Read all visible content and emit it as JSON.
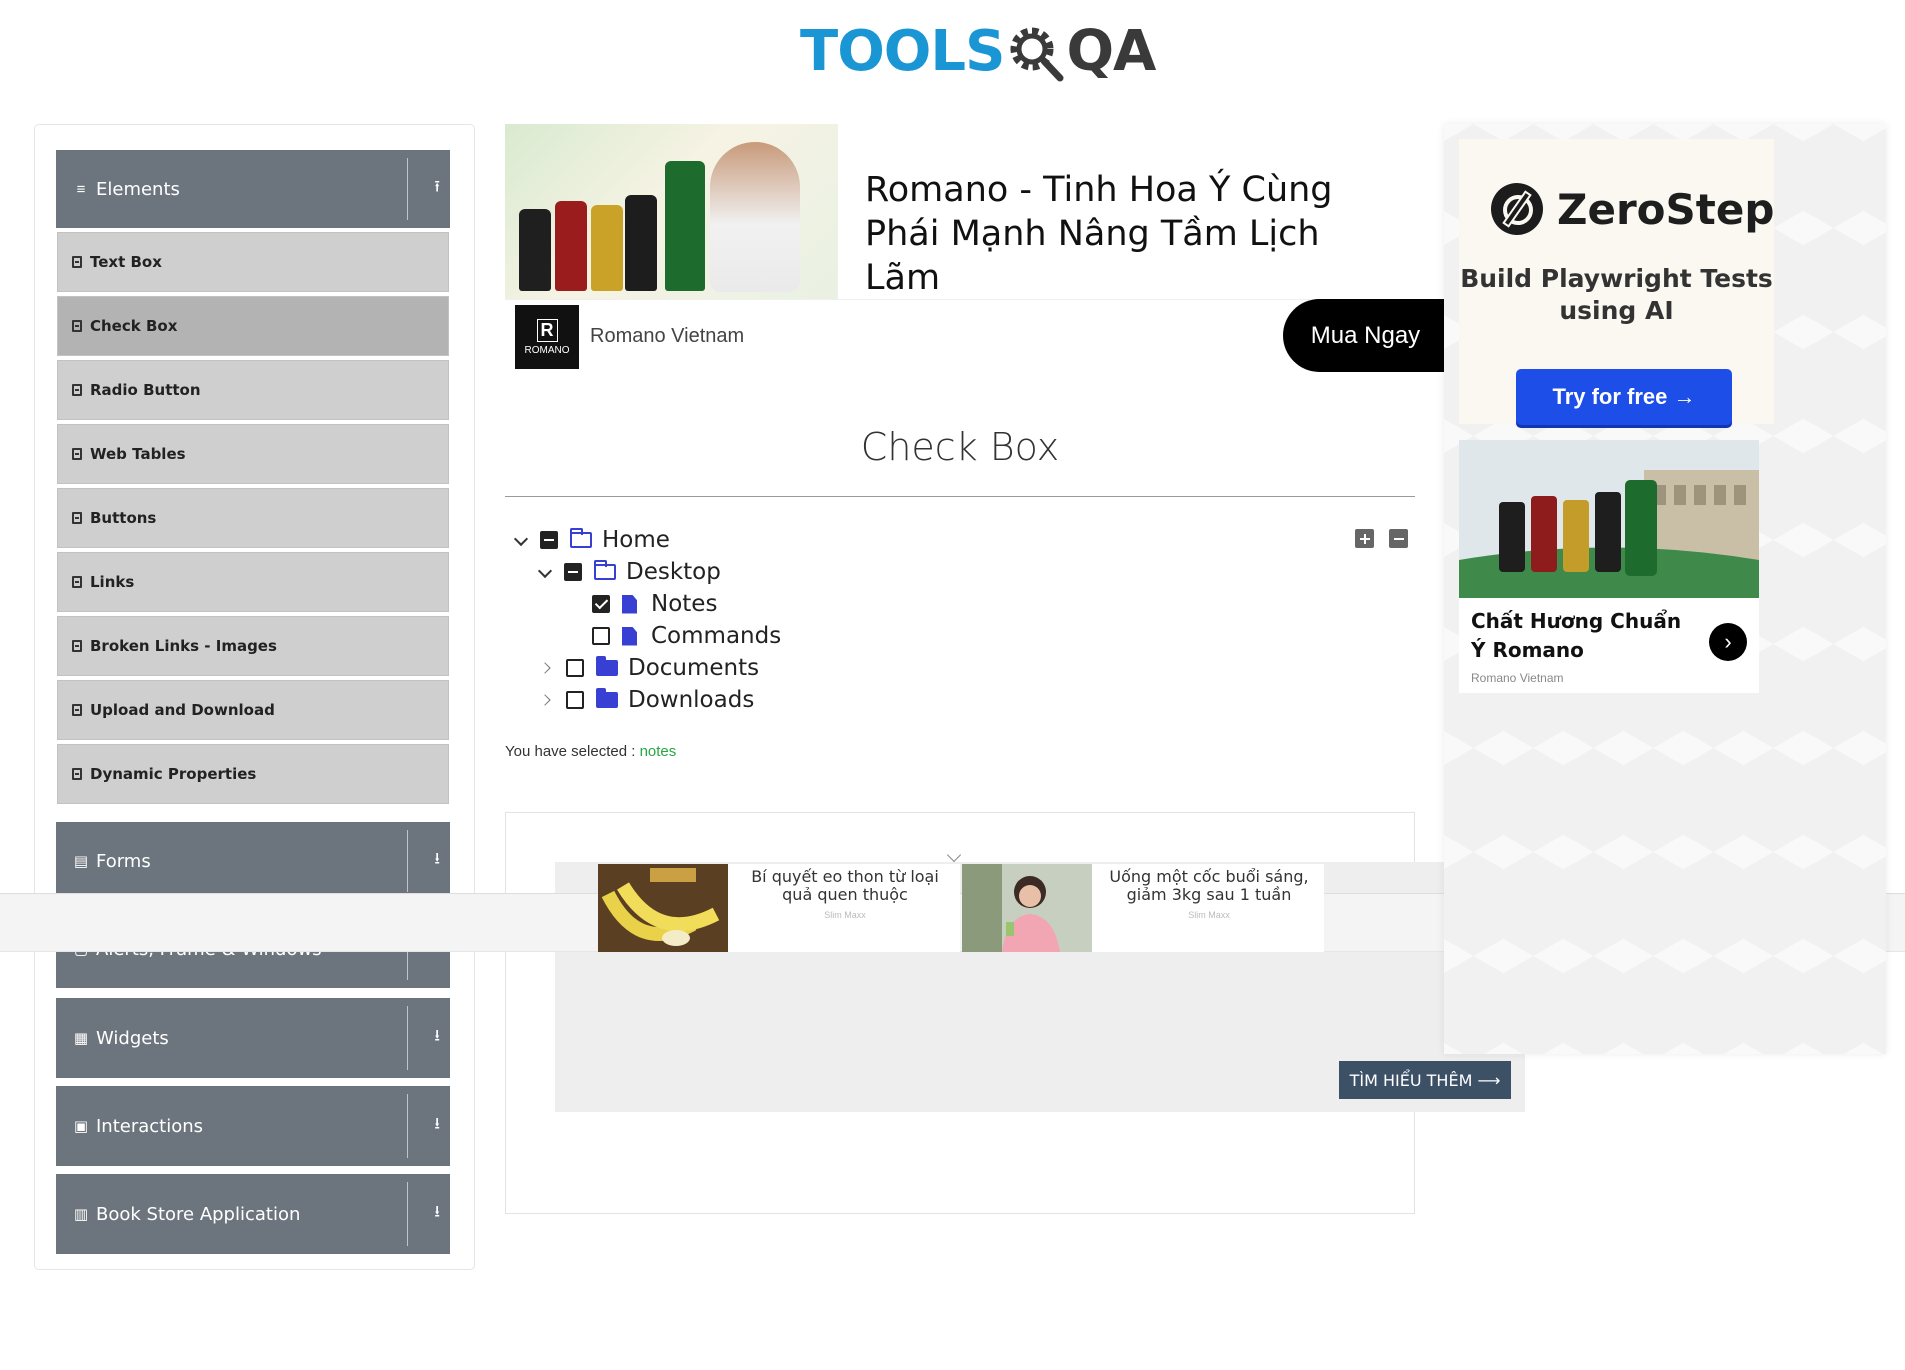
{
  "header": {
    "logo_tools": "TOOLS",
    "logo_qa": "QA"
  },
  "sidebar": {
    "groups": [
      {
        "label": "Elements",
        "icon": "hamburger-icon",
        "arrow": "collapse-arrow-icon"
      },
      {
        "label": "Forms",
        "icon": "form-icon",
        "arrow": "expand-arrow-icon"
      },
      {
        "label": "Alerts, Frame & Windows",
        "icon": "window-icon",
        "arrow": "expand-arrow-icon"
      },
      {
        "label": "Widgets",
        "icon": "widgets-icon",
        "arrow": "expand-arrow-icon"
      },
      {
        "label": "Interactions",
        "icon": "interactions-icon",
        "arrow": "expand-arrow-icon"
      },
      {
        "label": "Book Store Application",
        "icon": "book-icon",
        "arrow": "expand-arrow-icon"
      }
    ],
    "items": [
      {
        "label": "Text Box"
      },
      {
        "label": "Check Box",
        "active": true
      },
      {
        "label": "Radio Button"
      },
      {
        "label": "Web Tables"
      },
      {
        "label": "Buttons"
      },
      {
        "label": "Links"
      },
      {
        "label": "Broken Links - Images"
      },
      {
        "label": "Upload and Download"
      },
      {
        "label": "Dynamic Properties"
      }
    ]
  },
  "top_ad": {
    "headline": "Romano - Tinh Hoa Ý Cùng Phái Mạnh Nâng Tầm Lịch Lãm",
    "brand_logo": "ROMANO",
    "brand_logo_mark": "R",
    "brand_name": "Romano Vietnam",
    "cta": "Mua Ngay"
  },
  "main": {
    "title": "Check Box",
    "tree": [
      {
        "label": "Home",
        "level": 0,
        "caret": "down",
        "state": "half",
        "icon": "folder-open"
      },
      {
        "label": "Desktop",
        "level": 1,
        "caret": "down",
        "state": "half",
        "icon": "folder-open"
      },
      {
        "label": "Notes",
        "level": 2,
        "caret": "none",
        "state": "checked",
        "icon": "file"
      },
      {
        "label": "Commands",
        "level": 2,
        "caret": "none",
        "state": "unchecked",
        "icon": "file"
      },
      {
        "label": "Documents",
        "level": 1,
        "caret": "right",
        "state": "unchecked",
        "icon": "folder-closed"
      },
      {
        "label": "Downloads",
        "level": 1,
        "caret": "right",
        "state": "unchecked",
        "icon": "folder-closed"
      }
    ],
    "selected_prefix": "You have selected :",
    "selected_value": "notes"
  },
  "lower_ad": {
    "cards": [
      {
        "title": "Bí quyết eo thon từ loại quả quen thuộc",
        "source": "Slim Maxx"
      },
      {
        "title": "Uống một cốc buổi sáng, giảm 3kg sau 1 tuần",
        "source": "Slim Maxx"
      }
    ],
    "learn_more": "TÌM HIỂU THÊM ⟶"
  },
  "right_ad": {
    "zerostep_name": "ZeroStep",
    "zerostep_tagline": "Build Playwright Tests using AI",
    "zerostep_cta": "Try for free →",
    "romano_title": "Chất Hương Chuẩn Ý Romano",
    "romano_source": "Romano Vietnam"
  },
  "colors": {
    "sidebar_header": "#6c757d",
    "menu_item": "#cfcfcf",
    "menu_active": "#b3b3b3",
    "tree_icon": "#3840d3",
    "selected": "#28a745",
    "zerostep_button": "#1e4ee8",
    "logo_blue": "#1a96d4"
  }
}
